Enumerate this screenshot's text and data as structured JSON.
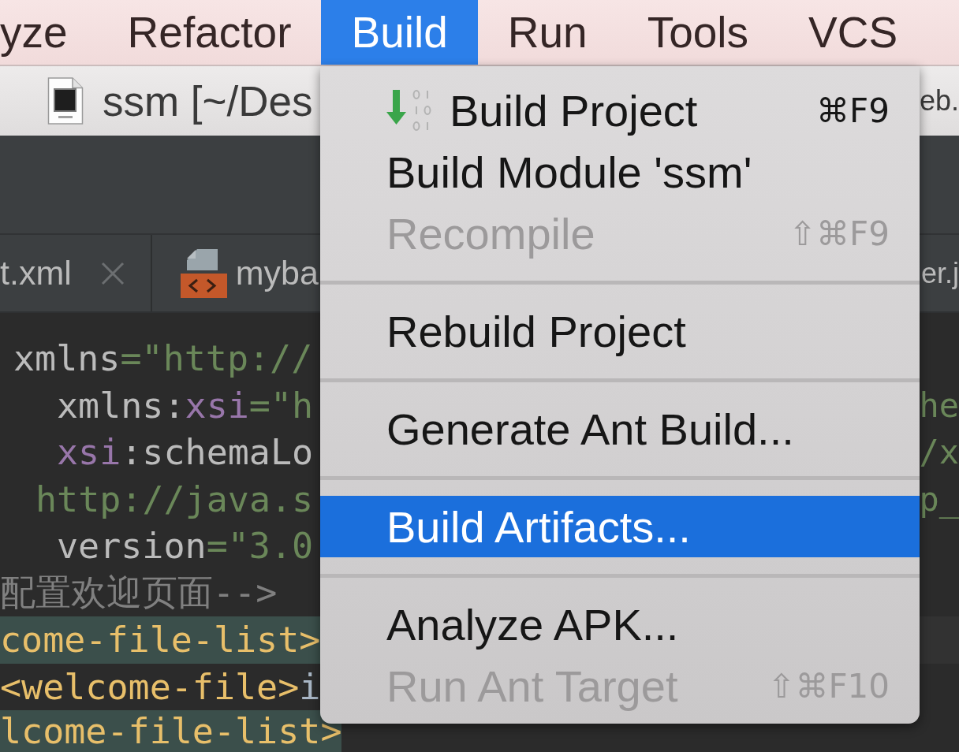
{
  "menu_bar": {
    "items": [
      {
        "label": "yze",
        "selected": false
      },
      {
        "label": "Refactor",
        "selected": false
      },
      {
        "label": "Build",
        "selected": true
      },
      {
        "label": "Run",
        "selected": false
      },
      {
        "label": "Tools",
        "selected": false
      },
      {
        "label": "VCS",
        "selected": false
      }
    ]
  },
  "title_bar": {
    "title": "ssm [~/Des",
    "title_end": "eb."
  },
  "editor_tabs": {
    "tabs": [
      {
        "label": "t.xml",
        "close_button": true,
        "file_icon": false
      },
      {
        "label": "myba",
        "close_button": false,
        "file_icon": true
      }
    ],
    "tabs_end": "er.j"
  },
  "code_lines": [
    {
      "segments": [
        {
          "kind": "attr",
          "text": "xmlns"
        },
        {
          "kind": "string",
          "text": "=\"http://"
        }
      ],
      "highlighted": false,
      "current": false
    },
    {
      "segments": [
        {
          "kind": "attr",
          "text": "xmlns:"
        },
        {
          "kind": "namespace",
          "text": "xsi"
        },
        {
          "kind": "string",
          "text": "=\"h"
        }
      ],
      "tail": [
        {
          "kind": "string",
          "text": "he"
        }
      ],
      "highlighted": false,
      "current": false
    },
    {
      "segments": [
        {
          "kind": "namespace",
          "text": "xsi"
        },
        {
          "kind": "attr",
          "text": ":schemaLo"
        }
      ],
      "tail": [
        {
          "kind": "string",
          "text": "/x"
        }
      ],
      "highlighted": false,
      "current": false
    },
    {
      "segments": [
        {
          "kind": "string",
          "text": "http://java.s"
        }
      ],
      "tail": [
        {
          "kind": "string",
          "text": "p_"
        }
      ],
      "highlighted": false,
      "current": false
    },
    {
      "segments": [
        {
          "kind": "attr",
          "text": "version"
        },
        {
          "kind": "string",
          "text": "=\"3.0"
        }
      ],
      "highlighted": false,
      "current": false
    },
    {
      "segments": [
        {
          "kind": "comment",
          "text": "配置欢迎页面-->"
        }
      ],
      "highlighted": false,
      "current": false
    },
    {
      "segments": [
        {
          "kind": "tag",
          "text": "come-file-list>"
        }
      ],
      "highlighted": true,
      "current": true
    },
    {
      "segments": [
        {
          "kind": "tag",
          "text": "<welcome-file>"
        },
        {
          "kind": "text",
          "text": "i"
        }
      ],
      "highlighted": false,
      "current": false
    },
    {
      "segments": [
        {
          "kind": "tag",
          "text": "lcome-file-list>"
        }
      ],
      "highlighted": true,
      "current": false
    }
  ],
  "build_menu": {
    "items": [
      {
        "kind": "icon_item",
        "label": "Build Project",
        "shortcut": "⌘F9",
        "disabled": false,
        "selected": false
      },
      {
        "kind": "item",
        "label": "Build Module 'ssm'",
        "disabled": false,
        "selected": false
      },
      {
        "kind": "item",
        "label": "Recompile",
        "shortcut": "⇧⌘F9",
        "disabled": true,
        "selected": false
      },
      {
        "kind": "separator"
      },
      {
        "kind": "item",
        "label": "Rebuild Project",
        "disabled": false,
        "selected": false
      },
      {
        "kind": "separator"
      },
      {
        "kind": "item",
        "label": "Generate Ant Build...",
        "disabled": false,
        "selected": false
      },
      {
        "kind": "separator"
      },
      {
        "kind": "item",
        "label": "Build Artifacts...",
        "disabled": false,
        "selected": true
      },
      {
        "kind": "separator"
      },
      {
        "kind": "item",
        "label": "Analyze APK...",
        "disabled": false,
        "selected": false
      },
      {
        "kind": "item",
        "label": "Run Ant Target",
        "shortcut": "⇧⌘F10",
        "disabled": true,
        "selected": false
      }
    ]
  }
}
